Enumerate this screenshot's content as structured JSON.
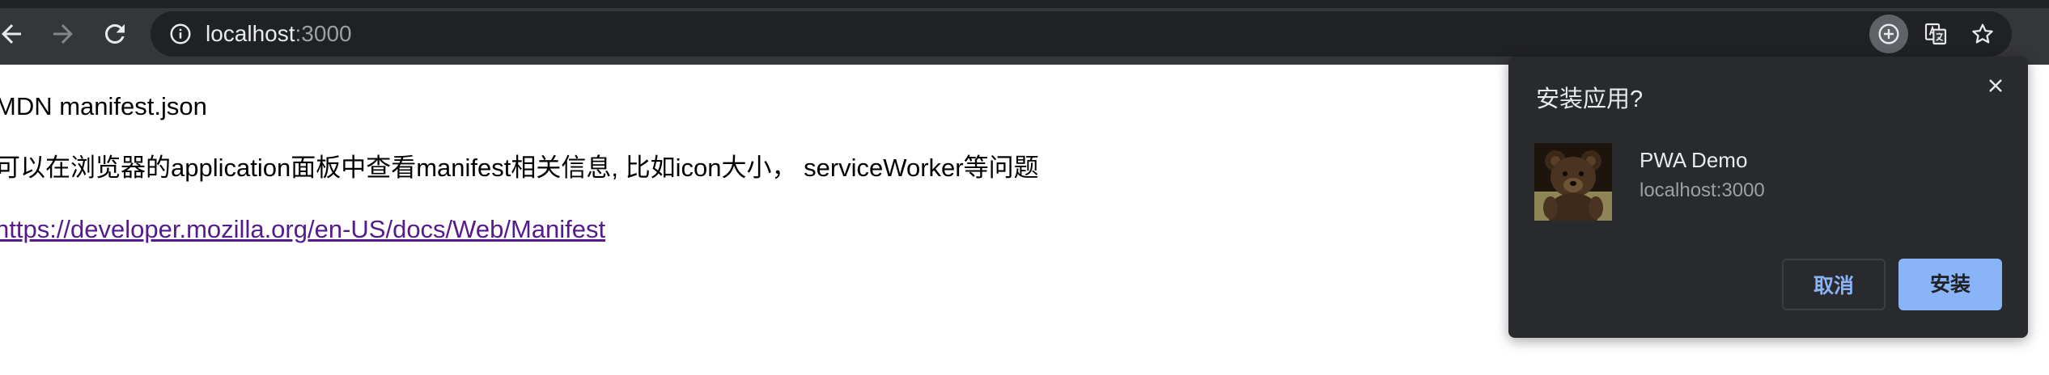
{
  "browser": {
    "url_host": "localhost",
    "url_port": ":3000",
    "accent_color": "#8ab4f8"
  },
  "page": {
    "lines": [
      "MDN manifest.json",
      "可以在浏览器的application面板中查看manifest相关信息, 比如icon大小， serviceWorker等问题",
      "https://developer.mozilla.org/en-US/docs/Web/Manifest"
    ]
  },
  "install_dialog": {
    "title": "安装应用?",
    "app_name": "PWA Demo",
    "app_origin": "localhost:3000",
    "cancel_label": "取消",
    "install_label": "安装"
  }
}
